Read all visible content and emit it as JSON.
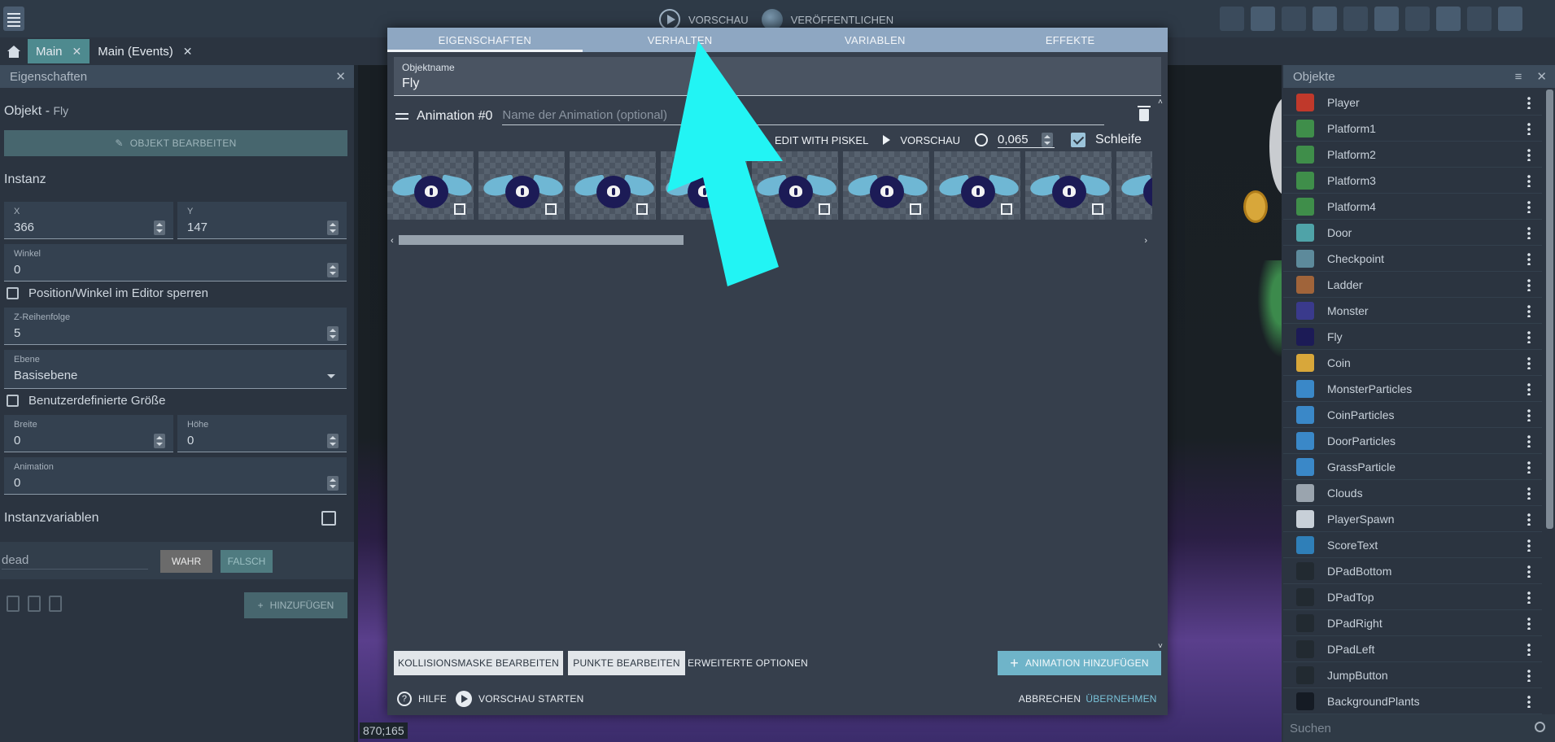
{
  "toolbar": {
    "preview_label": "VORSCHAU",
    "publish_label": "VERÖFFENTLICHEN",
    "icons": [
      "scene-editor-icon",
      "object-groups-icon",
      "edit-icon",
      "layers-icon",
      "instances-icon",
      "undo-icon",
      "redo-icon",
      "preview-window-icon",
      "grid-icon",
      "zoom-icon"
    ]
  },
  "tabs": [
    {
      "label": "Main",
      "active": true
    },
    {
      "label": "Main (Events)",
      "active": false
    }
  ],
  "left_panel": {
    "title": "Eigenschaften",
    "object_label": "Objekt",
    "object_name": "Fly",
    "edit_object_button": "OBJEKT BEARBEITEN",
    "instance_heading": "Instanz",
    "x_label": "X",
    "x_value": "366",
    "y_label": "Y",
    "y_value": "147",
    "angle_label": "Winkel",
    "angle_value": "0",
    "lock_label": "Position/Winkel im Editor sperren",
    "z_label": "Z-Reihenfolge",
    "z_value": "5",
    "layer_label": "Ebene",
    "layer_value": "Basisebene",
    "custom_size_label": "Benutzerdefinierte Größe",
    "width_label": "Breite",
    "width_value": "0",
    "height_label": "Höhe",
    "height_value": "0",
    "animation_label": "Animation",
    "animation_value": "0",
    "instance_vars_heading": "Instanzvariablen",
    "var_name": "dead",
    "true_button": "WAHR",
    "false_button": "FALSCH",
    "add_button": "HINZUFÜGEN"
  },
  "canvas": {
    "coords": "870;165"
  },
  "right_panel": {
    "title": "Objekte",
    "search_placeholder": "Suchen",
    "objects": [
      {
        "name": "Player",
        "color": "#c0392b"
      },
      {
        "name": "Platform1",
        "color": "#3f8e4a"
      },
      {
        "name": "Platform2",
        "color": "#3f8e4a"
      },
      {
        "name": "Platform3",
        "color": "#3f8e4a"
      },
      {
        "name": "Platform4",
        "color": "#3f8e4a"
      },
      {
        "name": "Door",
        "color": "#4fa3a8"
      },
      {
        "name": "Checkpoint",
        "color": "#5d8a9b"
      },
      {
        "name": "Ladder",
        "color": "#a0643a"
      },
      {
        "name": "Monster",
        "color": "#3a3a8c"
      },
      {
        "name": "Fly",
        "color": "#1c1b56"
      },
      {
        "name": "Coin",
        "color": "#d8a73a"
      },
      {
        "name": "MonsterParticles",
        "color": "#3a88c8"
      },
      {
        "name": "CoinParticles",
        "color": "#3a88c8"
      },
      {
        "name": "DoorParticles",
        "color": "#3a88c8"
      },
      {
        "name": "GrassParticle",
        "color": "#3a88c8"
      },
      {
        "name": "Clouds",
        "color": "#9aa4ae"
      },
      {
        "name": "PlayerSpawn",
        "color": "#c8d0d8"
      },
      {
        "name": "ScoreText",
        "color": "#2f7fb8"
      },
      {
        "name": "DPadBottom",
        "color": "#222a31"
      },
      {
        "name": "DPadTop",
        "color": "#222a31"
      },
      {
        "name": "DPadRight",
        "color": "#222a31"
      },
      {
        "name": "DPadLeft",
        "color": "#222a31"
      },
      {
        "name": "JumpButton",
        "color": "#222a31"
      },
      {
        "name": "BackgroundPlants",
        "color": "#151b24"
      }
    ]
  },
  "dialog": {
    "tabs": [
      "EIGENSCHAFTEN",
      "VERHALTEN",
      "VARIABLEN",
      "EFFEKTE"
    ],
    "object_name_label": "Objektname",
    "object_name_value": "Fly",
    "animation_title": "Animation #0",
    "animation_name_placeholder": "Name der Animation (optional)",
    "edit_with_piskel": "EDIT WITH PISKEL",
    "preview": "VORSCHAU",
    "timer_value": "0,065",
    "loop_label": "Schleife",
    "frame_count": 9,
    "collision_mask_button": "KOLLISIONSMASKE BEARBEITEN",
    "points_button": "PUNKTE BEARBEITEN",
    "advanced_options": "ERWEITERTE OPTIONEN",
    "add_animation_button": "ANIMATION HINZUFÜGEN",
    "help_label": "HILFE",
    "start_preview_label": "VORSCHAU STARTEN",
    "cancel_label": "ABBRECHEN",
    "apply_label": "ÜBERNEHMEN",
    "accent_color": "#6fb4c9",
    "tab_bar_color": "#8ea7c2"
  },
  "annotation": {
    "arrow_color": "#22f4f4"
  }
}
